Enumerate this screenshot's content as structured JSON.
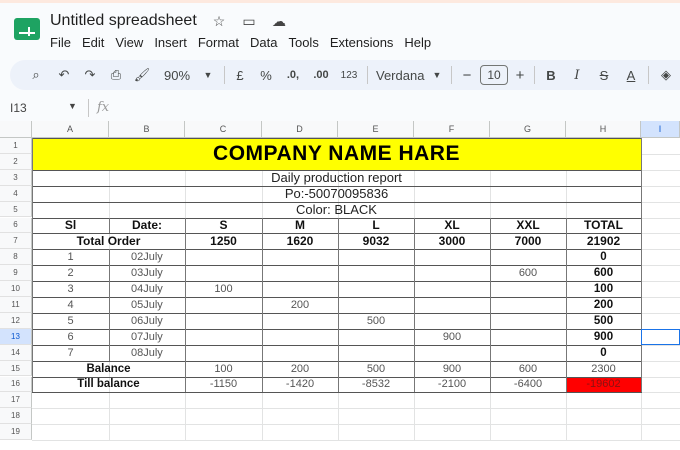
{
  "app": {
    "title": "Untitled spreadsheet",
    "menu": [
      "File",
      "Edit",
      "View",
      "Insert",
      "Format",
      "Data",
      "Tools",
      "Extensions",
      "Help"
    ]
  },
  "toolbar": {
    "zoom": "90%",
    "currency": "£",
    "percent": "%",
    "dec_decrease": ".0,",
    "dec_increase": ".00",
    "number_format": "123",
    "font": "Verdana",
    "font_size": "10",
    "minus": "−",
    "plus": "+",
    "bold": "B",
    "italic": "I",
    "strike": "S",
    "text_color": "A"
  },
  "formula_bar": {
    "name_box": "I13",
    "fx": "fx"
  },
  "columns": [
    "A",
    "B",
    "C",
    "D",
    "E",
    "F",
    "G",
    "H",
    "I"
  ],
  "rows": [
    "1",
    "2",
    "3",
    "4",
    "5",
    "6",
    "7",
    "8",
    "9",
    "10",
    "11",
    "12",
    "13",
    "14",
    "15",
    "16",
    "17",
    "18",
    "19"
  ],
  "selected_cell": {
    "column": "I",
    "row": "13"
  },
  "sheet": {
    "company": "COMPANY NAME HARE",
    "report": "Daily production report",
    "po": "Po:-50070095836",
    "color": "Color: BLACK",
    "header": [
      "Sl",
      "Date:",
      "S",
      "M",
      "L",
      "XL",
      "XXL",
      "TOTAL"
    ],
    "total_order": {
      "label": "Total Order",
      "values": [
        "1250",
        "1620",
        "9032",
        "3000",
        "7000",
        "21902"
      ]
    },
    "days": [
      {
        "sl": "1",
        "date": "02July",
        "s": "",
        "m": "",
        "l": "",
        "xl": "",
        "xxl": "",
        "total": "0"
      },
      {
        "sl": "2",
        "date": "03July",
        "s": "",
        "m": "",
        "l": "",
        "xl": "",
        "xxl": "600",
        "total": "600"
      },
      {
        "sl": "3",
        "date": "04July",
        "s": "100",
        "m": "",
        "l": "",
        "xl": "",
        "xxl": "",
        "total": "100"
      },
      {
        "sl": "4",
        "date": "05July",
        "s": "",
        "m": "200",
        "l": "",
        "xl": "",
        "xxl": "",
        "total": "200"
      },
      {
        "sl": "5",
        "date": "06July",
        "s": "",
        "m": "",
        "l": "500",
        "xl": "",
        "xxl": "",
        "total": "500"
      },
      {
        "sl": "6",
        "date": "07July",
        "s": "",
        "m": "",
        "l": "",
        "xl": "900",
        "xxl": "",
        "total": "900"
      },
      {
        "sl": "7",
        "date": "08July",
        "s": "",
        "m": "",
        "l": "",
        "xl": "",
        "xxl": "",
        "total": "0"
      }
    ],
    "balance": {
      "label": "Balance",
      "values": [
        "100",
        "200",
        "500",
        "900",
        "600",
        "2300"
      ]
    },
    "till_balance": {
      "label": "Till balance",
      "values": [
        "-1150",
        "-1420",
        "-8532",
        "-2100",
        "-6400",
        "-19602"
      ]
    }
  },
  "colors": {
    "title_fill": "#ffff00",
    "negative_total_fill": "#ff0000",
    "selection": "#1a73e8"
  }
}
